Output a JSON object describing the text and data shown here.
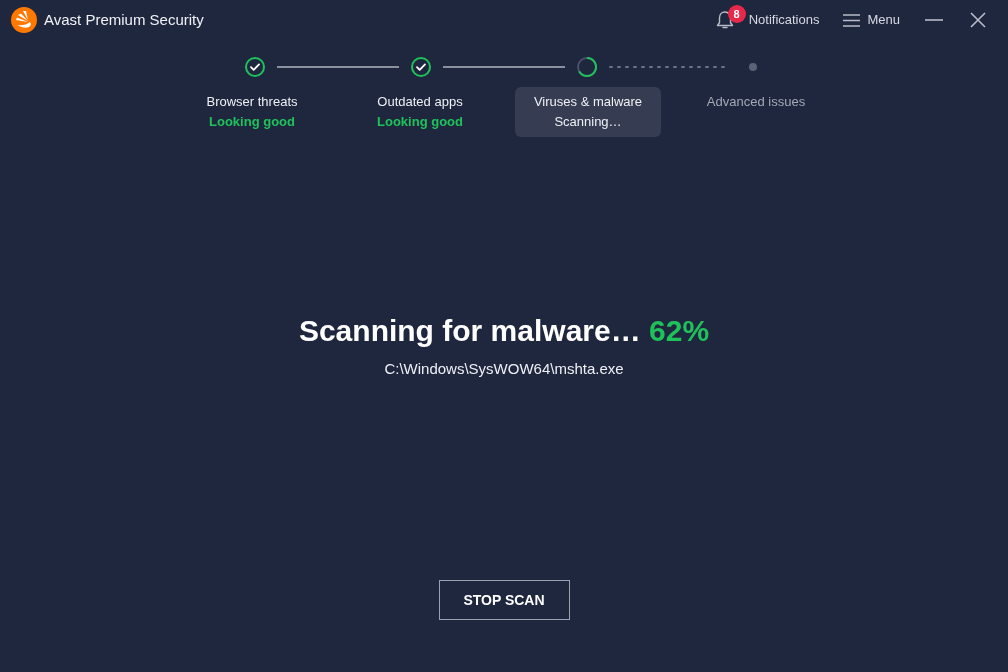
{
  "window": {
    "title": "Avast Premium Security"
  },
  "header": {
    "notifications": {
      "label": "Notifications",
      "count": "8"
    },
    "menu": {
      "label": "Menu"
    }
  },
  "steps": [
    {
      "kind": "done",
      "title": "Browser threats",
      "status": "Looking good",
      "selected": false
    },
    {
      "kind": "done",
      "title": "Outdated apps",
      "status": "Looking good",
      "selected": false
    },
    {
      "kind": "active",
      "title": "Viruses & malware",
      "status": "Scanning…",
      "selected": true
    },
    {
      "kind": "pending",
      "title": "Advanced issues",
      "selected": false
    }
  ],
  "scan": {
    "heading": "Scanning for malware…",
    "percent": "62%",
    "path": "C:\\Windows\\SysWOW64\\mshta.exe"
  },
  "buttons": [
    {
      "label": "STOP SCAN"
    }
  ]
}
